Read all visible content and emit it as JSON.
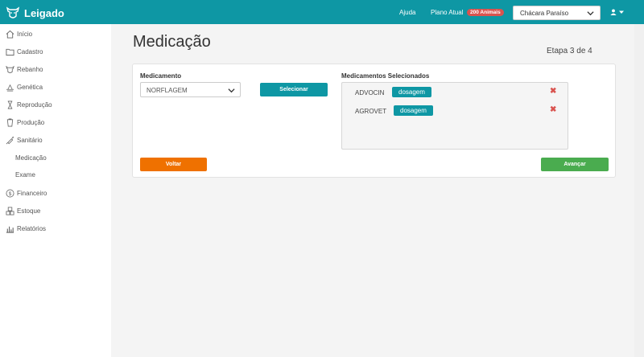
{
  "app": {
    "name": "Leigado"
  },
  "topbar": {
    "help_label": "Ajuda",
    "plan_label": "Plano Atual",
    "plan_badge": "200 Animais",
    "farm_selected": "Chácara Paraíso"
  },
  "sidebar": {
    "items": [
      {
        "label": "Início",
        "icon": "home-icon"
      },
      {
        "label": "Cadastro",
        "icon": "folder-icon"
      },
      {
        "label": "Rebanho",
        "icon": "cow-icon"
      },
      {
        "label": "Genética",
        "icon": "dna-icon"
      },
      {
        "label": "Reprodução",
        "icon": "hourglass-icon"
      },
      {
        "label": "Produção",
        "icon": "bucket-icon"
      },
      {
        "label": "Sanitário",
        "icon": "syringe-icon"
      },
      {
        "label": "Medicação",
        "icon": ""
      },
      {
        "label": "Exame",
        "icon": ""
      },
      {
        "label": "Financeiro",
        "icon": "dollar-icon"
      },
      {
        "label": "Estoque",
        "icon": "boxes-icon"
      },
      {
        "label": "Relatórios",
        "icon": "chart-icon"
      }
    ]
  },
  "page": {
    "title": "Medicação",
    "step": "Etapa 3 de 4"
  },
  "form": {
    "medicamento_label": "Medicamento",
    "medicamento_value": "NORFLAGEM",
    "select_button": "Selecionar",
    "selected_label": "Medicamentos Selecionados",
    "selected": [
      {
        "name": "ADVOCIN",
        "dose_label": "dosagem"
      },
      {
        "name": "AGROVET",
        "dose_label": "dosagem"
      }
    ],
    "back_button": "Voltar",
    "next_button": "Avançar"
  },
  "colors": {
    "primary": "#0e97a4",
    "danger": "#d9534f",
    "warning": "#ef7100",
    "success": "#4aac4f"
  }
}
